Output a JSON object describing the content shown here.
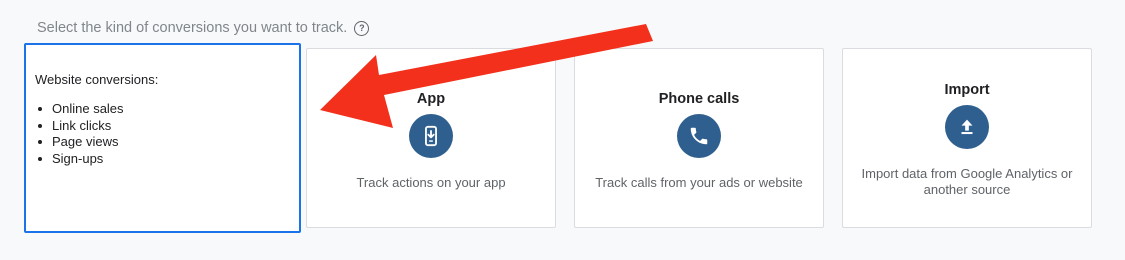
{
  "prompt": {
    "text": "Select the kind of conversions you want to track.",
    "help_icon": "?"
  },
  "cards": {
    "website": {
      "title": "Website conversions:",
      "items": [
        "Online sales",
        "Link clicks",
        "Page views",
        "Sign-ups"
      ],
      "selected": true
    },
    "app": {
      "title": "App",
      "icon": "mobile-download-icon",
      "description": "Track actions on your app"
    },
    "phone": {
      "title": "Phone calls",
      "icon": "phone-icon",
      "description": "Track calls from your ads or website"
    },
    "import": {
      "title": "Import",
      "icon": "upload-icon",
      "description": "Import data from Google Analytics or another source"
    }
  },
  "colors": {
    "selected_border": "#1a73e8",
    "icon_background": "#2f5f8f",
    "annotation_arrow": "#f2301b"
  }
}
